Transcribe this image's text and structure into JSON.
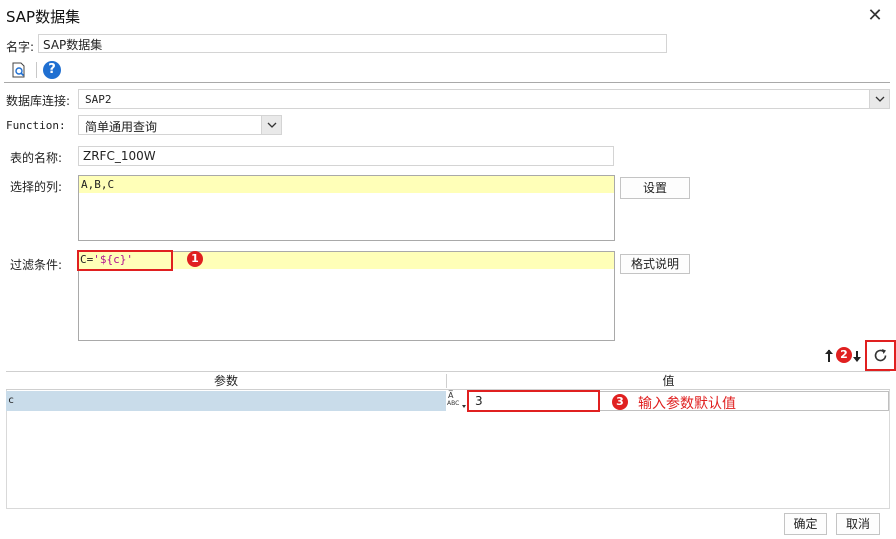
{
  "window": {
    "title": "SAP数据集",
    "close": "✕"
  },
  "name_row": {
    "label": "名字:",
    "value": "SAP数据集"
  },
  "db_row": {
    "label": "数据库连接:",
    "value": "SAP2"
  },
  "function_row": {
    "label": "Function:",
    "value": "简单通用查询"
  },
  "table_row": {
    "label": "表的名称:",
    "value": "ZRFC_100W"
  },
  "columns_row": {
    "label": "选择的列:",
    "value": "A,B,C",
    "button": "设置"
  },
  "filter_row": {
    "label": "过滤条件:",
    "value_prefix": "C=",
    "value_var": "'${c}'",
    "button": "格式说明"
  },
  "annotations": {
    "badge1": "1",
    "badge2": "2",
    "badge3": "3",
    "note3": "输入参数默认值"
  },
  "params": {
    "header_param": "参数",
    "header_value": "值",
    "rows": [
      {
        "param": "c",
        "value": "3"
      }
    ],
    "type_icon_top": "A̅",
    "type_icon_bottom": "ABC"
  },
  "footer": {
    "ok": "确定",
    "cancel": "取消"
  },
  "colors": {
    "highlight": "#ffffb8",
    "selected_row": "#c9dcea",
    "annotation_red": "#e02020",
    "help_blue": "#1f6fd1"
  }
}
